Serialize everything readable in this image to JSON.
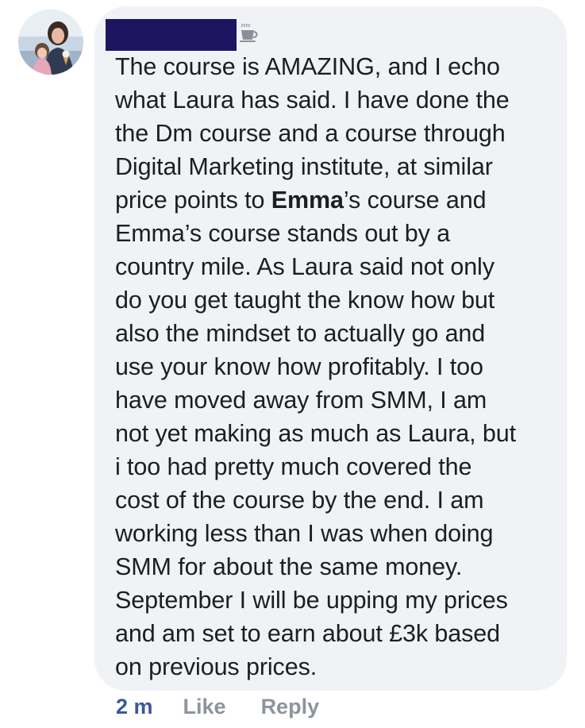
{
  "comment": {
    "avatar_icon": "profile-photo",
    "author_name_redacted": true,
    "badge_icon": "top-fan-cup-icon",
    "lines": [
      "The course is AMAZING, and I echo",
      "what Laura has said. I have done the",
      "the Dm course and a course through",
      "Digital Marketing institute, at similar",
      "price points to ",
      "’s course and",
      "Emma’s course stands out by a",
      "country mile. As Laura said not only",
      "do you get taught the know how but",
      "also the mindset to actually go and",
      "use your know how profitably. I too",
      "have moved away from SMM, I am",
      "not yet making as much as Laura, but",
      "i too had pretty much covered the",
      "cost of the course by the end. I am",
      "working less than I was when doing",
      "SMM for about the same money.",
      "September I will be upping my prices",
      "and am set to earn about £3k based",
      "on previous prices."
    ],
    "mention": "Emma"
  },
  "actions": {
    "timestamp": "2 m",
    "like_label": "Like",
    "reply_label": "Reply"
  },
  "colors": {
    "bubble_bg": "#f1f2f6",
    "text": "#1c1e21",
    "timestamp": "#3b5998",
    "action_gray": "#8d949e",
    "redaction": "#1d1560"
  }
}
